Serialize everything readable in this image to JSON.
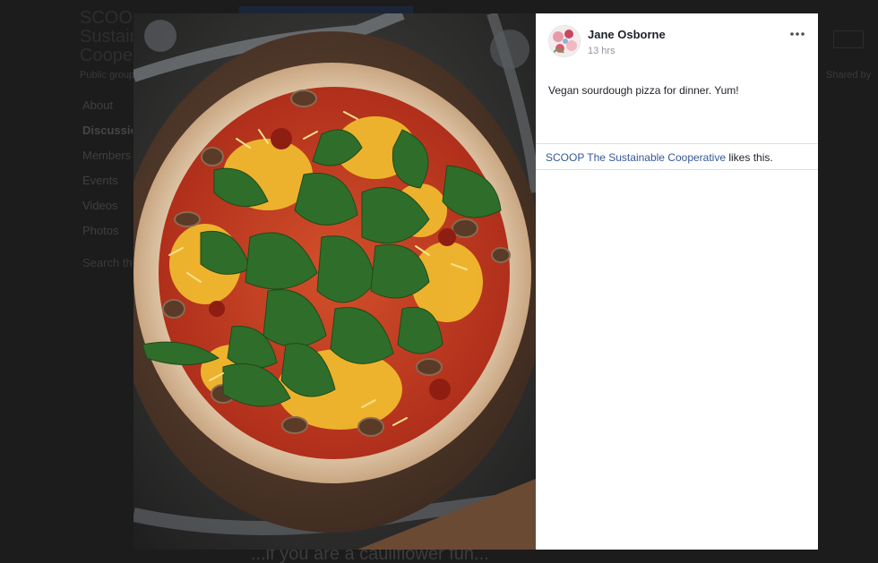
{
  "background_page": {
    "group_title_lines": [
      "SCOOP The",
      "Sustainable",
      "Cooperative"
    ],
    "privacy": "Public group",
    "nav_items": [
      "About",
      "Discussion",
      "Members",
      "Events",
      "Videos",
      "Photos"
    ],
    "active_nav": "Discussion",
    "search_placeholder": "Search this group",
    "right_label": "Shared by",
    "bottom_text": "...if you are a cauliflower fun..."
  },
  "post": {
    "author": "Jane Osborne",
    "time": "13 hrs",
    "text": "Vegan sourdough pizza for dinner. Yum!",
    "likes": {
      "liker": "SCOOP The Sustainable Cooperative",
      "suffix": " likes this."
    },
    "more_icon": "more-options-icon",
    "avatar_icon": "floral-avatar"
  },
  "photo": {
    "subject": "pizza-photo"
  },
  "colors": {
    "overlay": "#1c1c1c",
    "panel_bg": "#ffffff",
    "link": "#365899",
    "text": "#1d2129",
    "meta": "#90949c",
    "divider": "#dddfe2"
  }
}
